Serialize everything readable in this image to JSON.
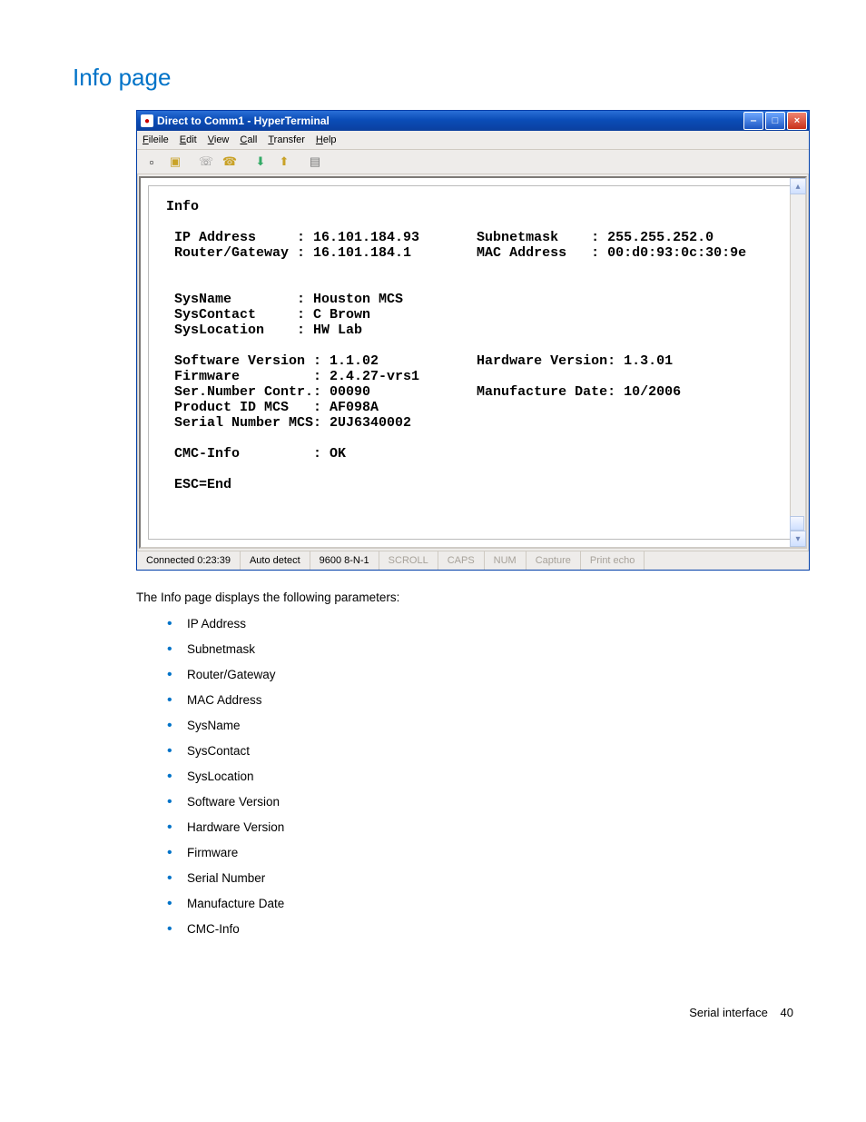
{
  "page": {
    "title": "Info page",
    "intro": "The Info page displays the following parameters:",
    "param_list": [
      "IP Address",
      "Subnetmask",
      "Router/Gateway",
      "MAC Address",
      "SysName",
      "SysContact",
      "SysLocation",
      "Software Version",
      "Hardware Version",
      "Firmware",
      "Serial Number",
      "Manufacture Date",
      "CMC-Info"
    ],
    "footer_label": "Serial interface",
    "footer_page": "40"
  },
  "window": {
    "title": "Direct to Comm1 - HyperTerminal",
    "menus": [
      "File",
      "Edit",
      "View",
      "Call",
      "Transfer",
      "Help"
    ],
    "toolbar_icons": [
      {
        "name": "new-icon",
        "glyph": "▫"
      },
      {
        "name": "open-icon",
        "glyph": "📂"
      },
      {
        "name": "connect-icon",
        "glyph": "☏"
      },
      {
        "name": "disconnect-icon",
        "glyph": "☎"
      },
      {
        "name": "send-icon",
        "glyph": "↧"
      },
      {
        "name": "receive-icon",
        "glyph": "↥"
      },
      {
        "name": "properties-icon",
        "glyph": "▤"
      }
    ],
    "status": {
      "connected": "Connected 0:23:39",
      "detect": "Auto detect",
      "baud": "9600 8-N-1",
      "flags": [
        "SCROLL",
        "CAPS",
        "NUM",
        "Capture",
        "Print echo"
      ]
    }
  },
  "terminal": {
    "heading": "Info",
    "ip_address_label": "IP Address",
    "ip_address": "16.101.184.93",
    "subnetmask_label": "Subnetmask",
    "subnetmask": "255.255.252.0",
    "router_label": "Router/Gateway",
    "router": "16.101.184.1",
    "mac_label": "MAC Address",
    "mac": "00:d0:93:0c:30:9e",
    "sysname_label": "SysName",
    "sysname": "Houston MCS",
    "syscontact_label": "SysContact",
    "syscontact": "C Brown",
    "syslocation_label": "SysLocation",
    "syslocation": "HW Lab",
    "swver_label": "Software Version",
    "swver": "1.1.02",
    "hwver_label": "Hardware Version",
    "hwver": "1.3.01",
    "fw_label": "Firmware",
    "fw": "2.4.27-vrs1",
    "serctr_label": "Ser.Number Contr.",
    "serctr": "00090",
    "mdate_label": "Manufacture Date",
    "mdate": "10/2006",
    "pid_label": "Product ID MCS",
    "pid": "AF098A",
    "sermcs_label": "Serial Number MCS",
    "sermcs": "2UJ6340002",
    "cmc_label": "CMC-Info",
    "cmc": "OK",
    "esc": "ESC=End"
  }
}
